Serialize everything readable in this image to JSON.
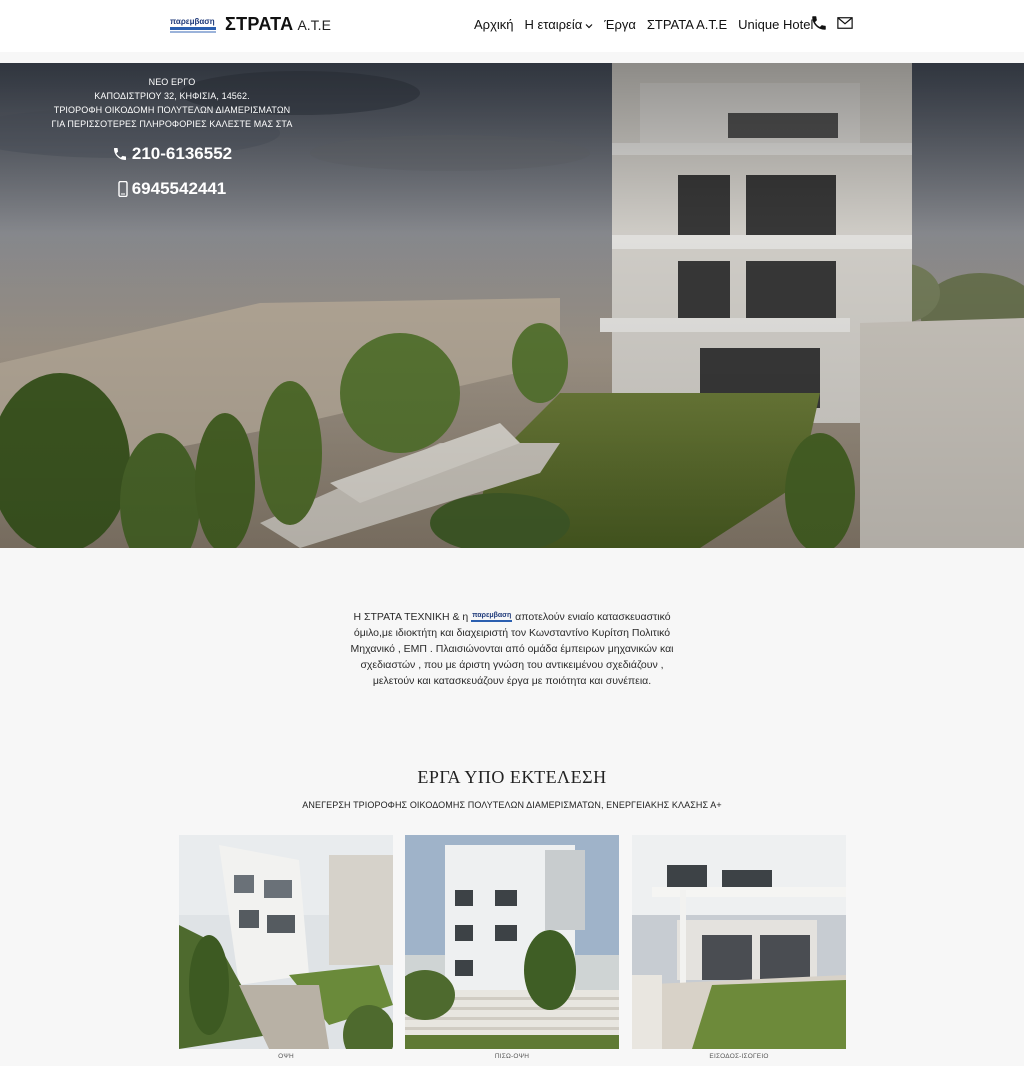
{
  "header": {
    "logo_mark": "παρεμβαση",
    "brand": "ΣΤΡΑΤΑ",
    "brand_suffix": "Α.Τ.Ε",
    "nav": [
      {
        "label": "Αρχική"
      },
      {
        "label": "Η εταιρεία"
      },
      {
        "label": "Έργα"
      },
      {
        "label": "ΣΤΡΑΤΑ Α.Τ.Ε"
      },
      {
        "label": "Unique Hotel"
      }
    ],
    "icons": [
      "phone-icon",
      "mail-icon"
    ]
  },
  "hero": {
    "lines": [
      "ΝΕΟ ΕΡΓΟ",
      "ΚΑΠΟΔΙΣΤΡΙΟΥ 32, ΚΗΦΙΣΙΑ, 14562.",
      "ΤΡΙΟΡΟΦΗ ΟΙΚΟΔΟΜΗ ΠΟΛΥΤΕΛΩΝ ΔΙΑΜΕΡΙΣΜΑΤΩΝ",
      "ΓΙΑ ΠΕΡΙΣΣΟΤΕΡΕΣ ΠΛΗΡΟΦΟΡΙΕΣ ΚΑΛΕΣΤΕ ΜΑΣ ΣΤΑ"
    ],
    "phone_landline": "210-6136552",
    "phone_mobile": "6945542441"
  },
  "about": {
    "prefix": "Η ΣΤΡΑΤΑ ΤΕΧΝΙΚΗ & η",
    "inline_logo": "παρεμβαση",
    "text": "αποτελούν ενιαίο κατασκευαστικό όμιλο,με ιδιοκτήτη και διαχειριστή τον Κωνσταντίνο Κυρίτση Πολιτικό Μηχανικό , ΕΜΠ . Πλαισιώνονται από ομάδα έμπειρων μηχανικών και σχεδιαστών , που με άριστη γνώση του αντικειμένου σχεδιάζουν , μελετούν και κατασκευάζουν έργα με ποιότητα και συνέπεια."
  },
  "projects": {
    "title": "ΕΡΓΑ ΥΠΟ ΕΚΤΕΛΕΣΗ",
    "subtitle": "ΑΝΕΓΕΡΣΗ ΤΡΙΟΡΟΦΗΣ ΟΙΚΟΔΟΜΗΣ ΠΟΛΥΤΕΛΩΝ ΔΙΑΜΕΡΙΣΜΑΤΩΝ, ΕΝΕΡΓΕΙΑΚΗΣ ΚΛΑΣΗΣ Α+",
    "cards": [
      {
        "caption": "ΟΨΗ"
      },
      {
        "caption": "ΠΙΣΩ-ΟΨΗ"
      },
      {
        "caption": "ΕΙΣΟΔΟΣ-ΙΣΟΓΕΙΟ"
      }
    ]
  }
}
